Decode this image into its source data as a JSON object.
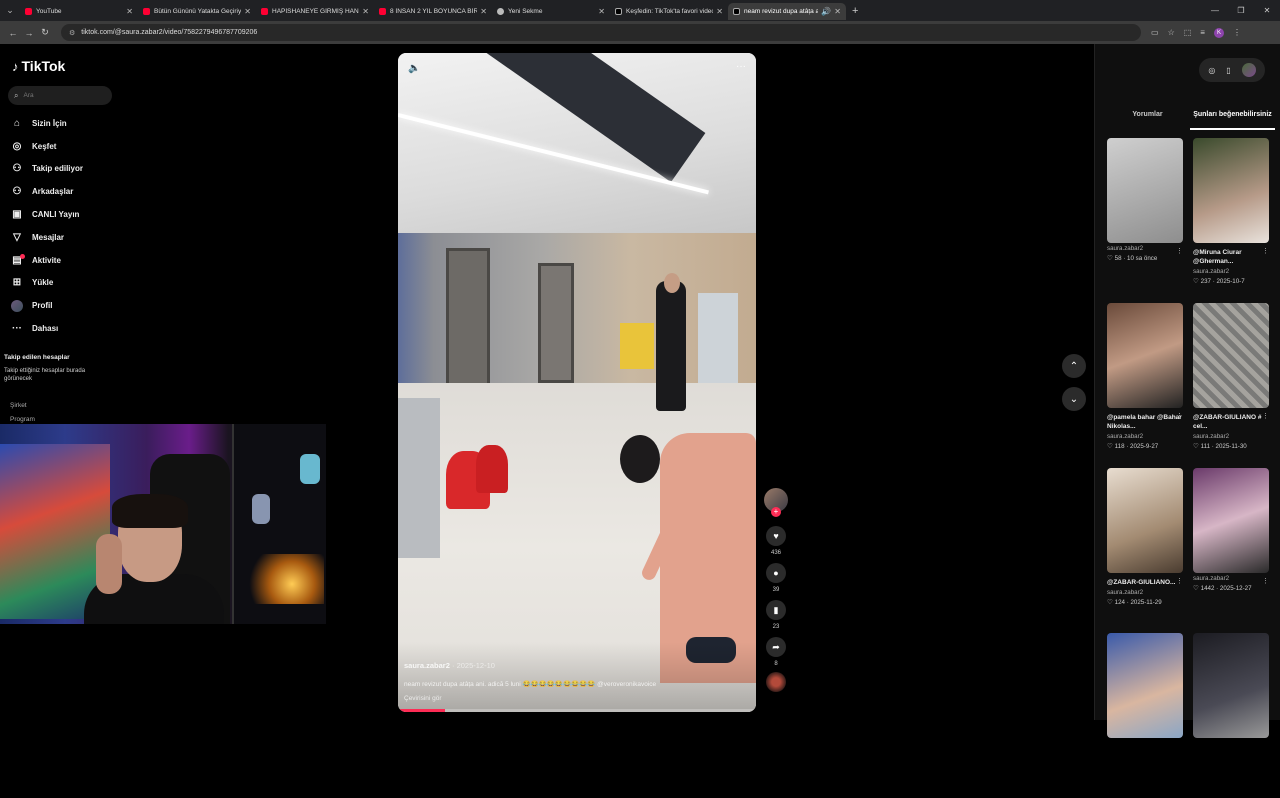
{
  "browser": {
    "tabs": [
      {
        "title": "YouTube",
        "favicon": "youtube-icon",
        "active": false
      },
      {
        "title": "Bütün Gününü Yatakta Geçiriyo...",
        "favicon": "youtube-icon",
        "active": false
      },
      {
        "title": "HAPİSHANEYE GİRMİŞ HANIM...",
        "favicon": "youtube-icon",
        "active": false
      },
      {
        "title": "8 İNSAN 2 YIL BOYUNCA BİR M...",
        "favicon": "youtube-icon",
        "active": false
      },
      {
        "title": "Yeni Sekme",
        "favicon": "chrome-icon",
        "active": false
      },
      {
        "title": "Keşfedin: TikTok'ta favori video...",
        "favicon": "tiktok-icon",
        "active": false
      },
      {
        "title": "neam revizut dupa atâța a...",
        "favicon": "tiktok-icon",
        "active": true
      }
    ],
    "url": "tiktok.com/@saura.zabar2/video/7582279496787709206",
    "profile_initial": "K"
  },
  "tiktok": {
    "logo": "TikTok",
    "search_placeholder": "Ara",
    "menu": [
      {
        "label": "Sizin İçin",
        "icon": "home-icon"
      },
      {
        "label": "Keşfet",
        "icon": "compass-icon"
      },
      {
        "label": "Takip ediliyor",
        "icon": "user-follow-icon"
      },
      {
        "label": "Arkadaşlar",
        "icon": "friends-icon"
      },
      {
        "label": "CANLI Yayın",
        "icon": "live-icon"
      },
      {
        "label": "Mesajlar",
        "icon": "send-icon"
      },
      {
        "label": "Aktivite",
        "icon": "activity-icon"
      },
      {
        "label": "Yükle",
        "icon": "upload-icon"
      },
      {
        "label": "Profil",
        "icon": "profile-avatar"
      },
      {
        "label": "Dahası",
        "icon": "more-icon"
      }
    ],
    "followed_title": "Takip edilen hesaplar",
    "followed_sub": "Takip ettiğiniz hesaplar burada görünecek",
    "footer": [
      "Şirket",
      "Program"
    ]
  },
  "video": {
    "author": "saura.zabar2",
    "date": "2025-12-10",
    "caption": "neam revizut dupa atâța ani. adică 5 luni 😂😂😂😂😂😂😂😂😂 @veroveronikavoice",
    "translate": "Çevirisini gör",
    "progress": 0.13,
    "likes": "436",
    "comments": "39",
    "saves": "23",
    "shares": "8"
  },
  "panel": {
    "tabs": [
      "Yorumlar",
      "Şunları beğenebilirsiniz"
    ],
    "active_tab": 1,
    "cards": [
      {
        "caption": "",
        "author": "saura.zabar2",
        "likes": "58",
        "date": "10 sa önce"
      },
      {
        "caption": "@Miruna Ciurar @Gherman...",
        "author": "saura.zabar2",
        "likes": "237",
        "date": "2025-10-7"
      },
      {
        "caption": "@pamela bahar @Bahar Nikolas...",
        "author": "saura.zabar2",
        "likes": "118",
        "date": "2025-9-27"
      },
      {
        "caption": "@ZABAR-GIULIANO # cel...",
        "author": "saura.zabar2",
        "likes": "111",
        "date": "2025-11-30"
      },
      {
        "caption": "@ZABAR-GIULIANO...",
        "author": "saura.zabar2",
        "likes": "124",
        "date": "2025-11-29"
      },
      {
        "caption": "",
        "author": "saura.zabar2",
        "likes": "1442",
        "date": "2025-12-27"
      },
      {
        "caption": "",
        "author": "",
        "likes": "",
        "date": ""
      },
      {
        "caption": "",
        "author": "",
        "likes": "",
        "date": ""
      }
    ]
  },
  "colors": {
    "accent": "#fe2c55",
    "background": "#000000"
  }
}
